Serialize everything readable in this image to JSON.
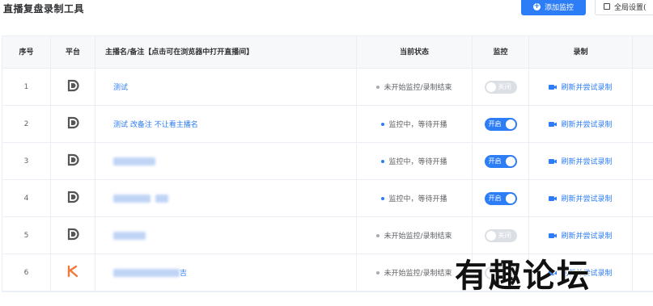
{
  "header": {
    "title": "直播复盘录制工具",
    "add_button": "添加监控",
    "settings_button": "全局设置("
  },
  "table": {
    "columns": [
      "序号",
      "平台",
      "主播名/备注【点击可在浏览器中打开直播间】",
      "当前状态",
      "监控",
      "录制"
    ],
    "rows": [
      {
        "index": "1",
        "platform": "douyin-icon",
        "name": "测试",
        "name_blurred": false,
        "status": "未开始监控/录制结束",
        "status_color": "grey",
        "monitor": "关闭",
        "monitor_on": false,
        "record": "刷新并尝试录制"
      },
      {
        "index": "2",
        "platform": "douyin-icon",
        "name": "测试 改备注 不让看主播名",
        "name_blurred": false,
        "status": "监控中，等待开播",
        "status_color": "blue",
        "monitor": "开启",
        "monitor_on": true,
        "record": "刷新并尝试录制"
      },
      {
        "index": "3",
        "platform": "douyin-icon",
        "name": "",
        "name_blurred": true,
        "status": "监控中，等待开播",
        "status_color": "blue",
        "monitor": "开启",
        "monitor_on": true,
        "record": "刷新并尝试录制"
      },
      {
        "index": "4",
        "platform": "douyin-icon",
        "name": "",
        "name_blurred": true,
        "status": "监控中，等待开播",
        "status_color": "blue",
        "monitor": "开启",
        "monitor_on": true,
        "record": "刷新并尝试录制"
      },
      {
        "index": "5",
        "platform": "douyin-icon",
        "name": "",
        "name_blurred": true,
        "status": "未开始监控/录制结束",
        "status_color": "grey",
        "monitor": "关闭",
        "monitor_on": false,
        "record": "刷新并尝试录制"
      },
      {
        "index": "6",
        "platform": "kuaishou-icon",
        "name": "",
        "name_suffix": "吉",
        "name_blurred": true,
        "status": "未开始监控/录制结束",
        "status_color": "grey",
        "monitor": "关闭",
        "monitor_on": false,
        "record": "刷新并尝试录制"
      }
    ]
  },
  "watermark": "有趣论坛",
  "colors": {
    "primary": "#2d7df6",
    "kuaishou": "#f4783c",
    "douyin": "#555555"
  }
}
